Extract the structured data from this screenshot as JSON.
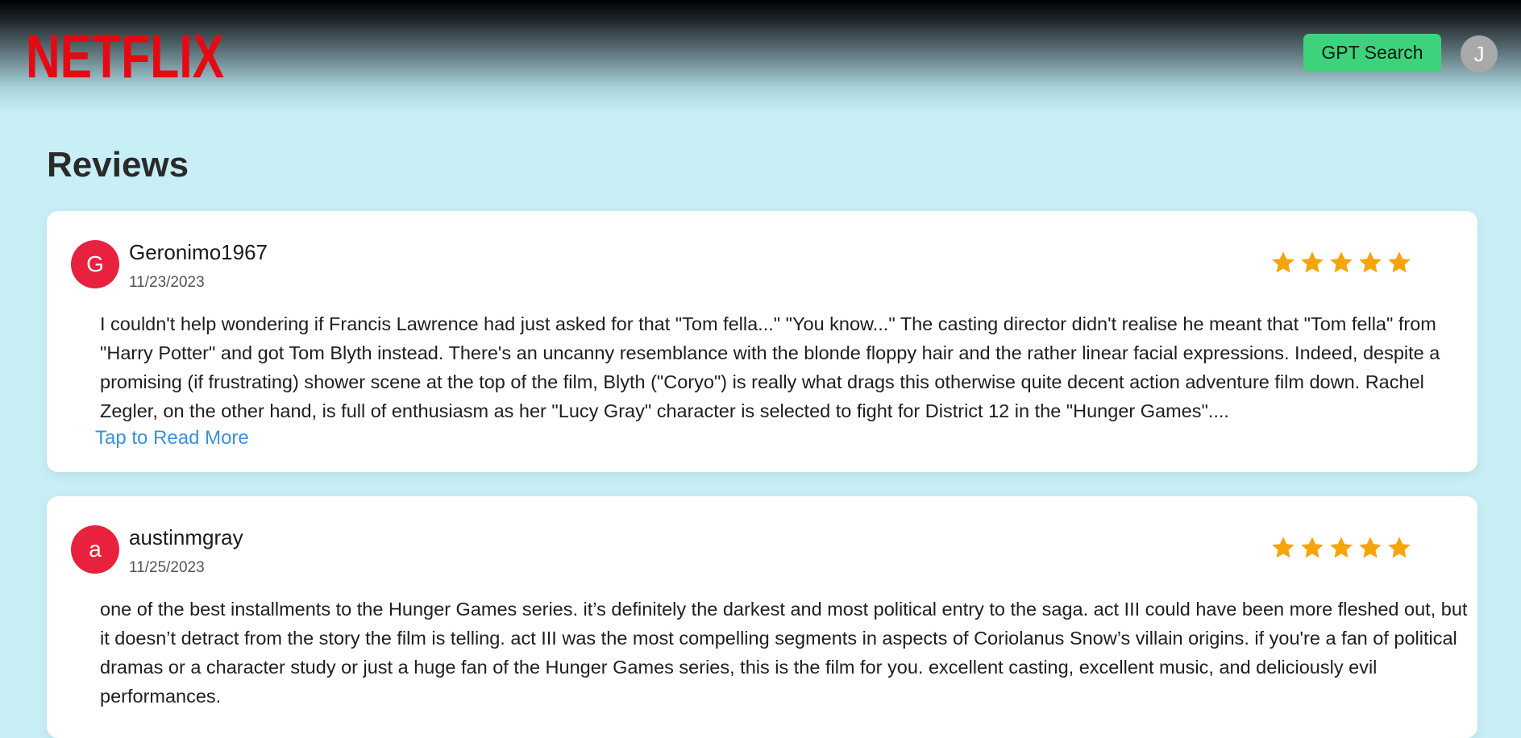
{
  "header": {
    "logo_text": "NETFLIX",
    "gpt_search_label": "GPT Search",
    "user_initial": "J",
    "brand_color": "#e50914",
    "button_color": "#3fd27d"
  },
  "section": {
    "title": "Reviews"
  },
  "reviews": [
    {
      "initial": "G",
      "author": "Geronimo1967",
      "date": "11/23/2023",
      "rating": 5,
      "text": "I couldn't help wondering if Francis Lawrence had just asked for that \"Tom fella...\" \"You know...\" The casting director didn't realise he meant that \"Tom fella\" from \"Harry Potter\" and got Tom Blyth instead. There's an uncanny resemblance with the blonde floppy hair and the rather linear facial expressions. Indeed, despite a promising (if frustrating) shower scene at the top of the film, Blyth (\"Coryo\") is really what drags this otherwise quite decent action adventure film down. Rachel Zegler, on the other hand, is full of enthusiasm as her \"Lucy Gray\" character is selected to fight for District 12 in the \"Hunger Games\"....",
      "read_more": "Tap to Read More"
    },
    {
      "initial": "a",
      "author": "austinmgray",
      "date": "11/25/2023",
      "rating": 5,
      "text": "one of the best installments to the Hunger Games series. it’s definitely the darkest and most political entry to the saga. act III could have been more fleshed out, but it doesn’t detract from the story the film is telling. act III was the most compelling segments in aspects of Coriolanus Snow’s villain origins. if you're a fan of political dramas or a character study or just a huge fan of the Hunger Games series, this is the film for you. excellent casting, excellent music, and deliciously evil performances."
    }
  ],
  "colors": {
    "star": "#f5a50a",
    "avatar": "#e8223e",
    "link": "#3b8fde",
    "background": "#c8eff6"
  }
}
